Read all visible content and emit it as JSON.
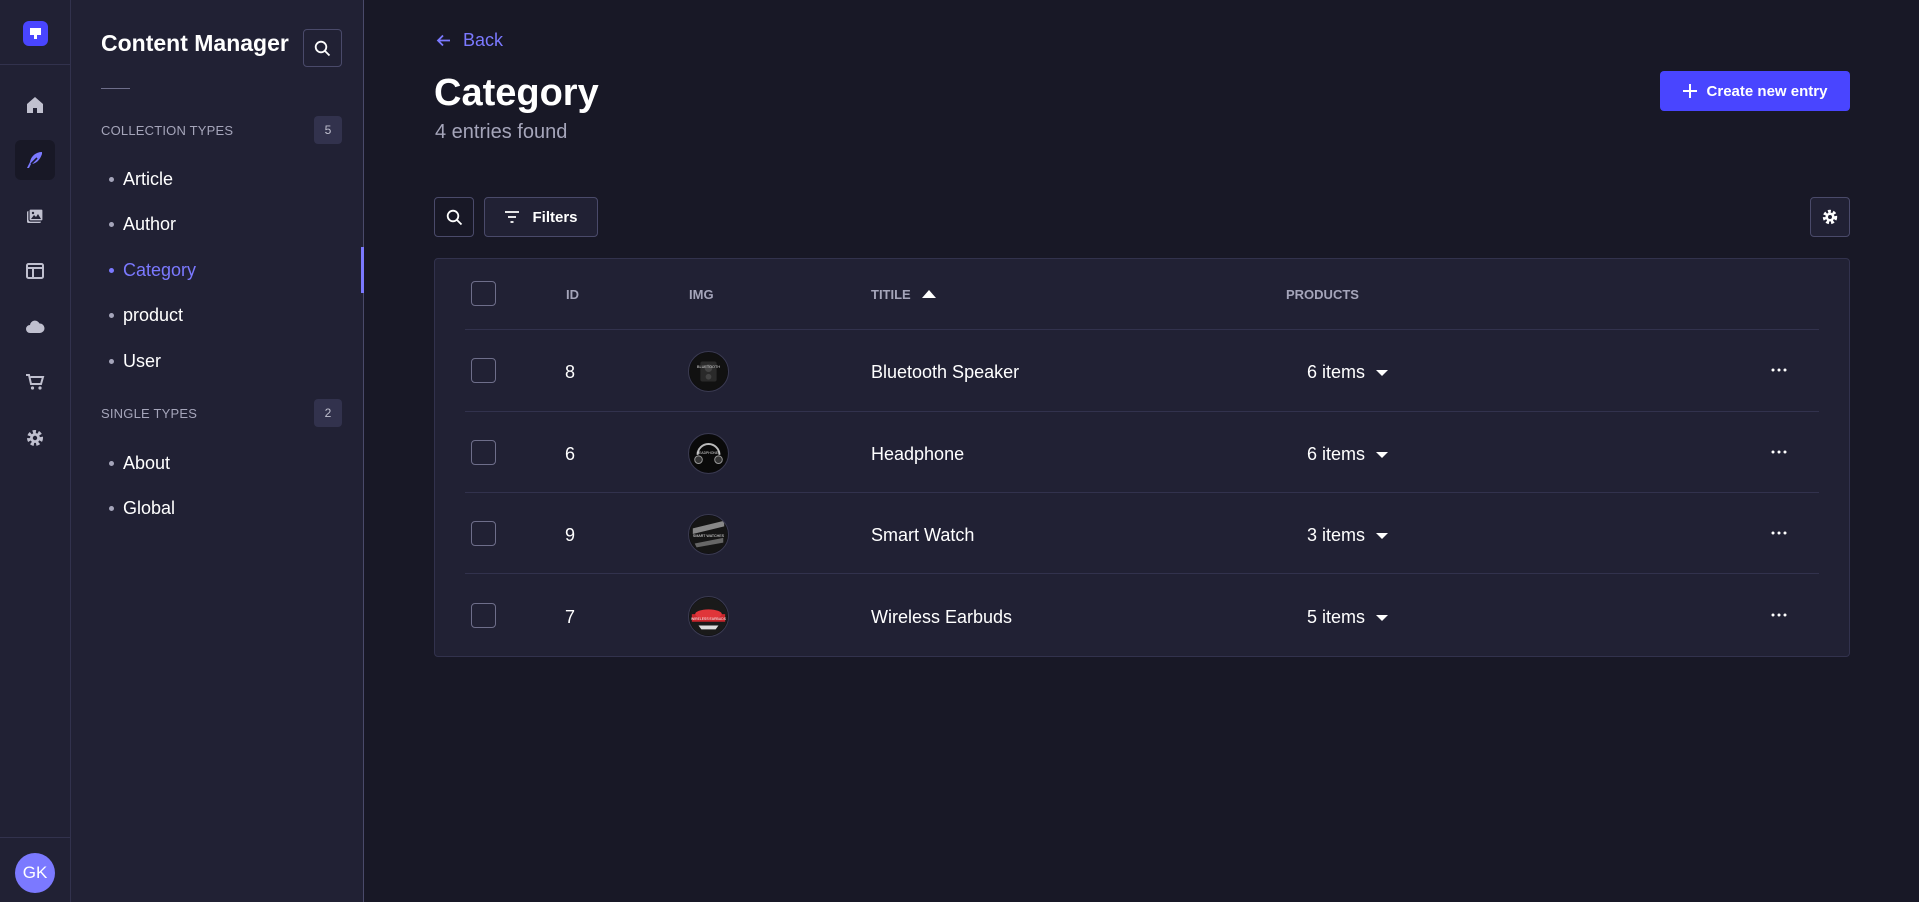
{
  "sidebar": {
    "title": "Content Manager",
    "collection_types": {
      "heading": "COLLECTION TYPES",
      "count": "5",
      "items": [
        {
          "label": "Article"
        },
        {
          "label": "Author"
        },
        {
          "label": "Category"
        },
        {
          "label": "product"
        },
        {
          "label": "User"
        }
      ]
    },
    "single_types": {
      "heading": "SINGLE TYPES",
      "count": "2",
      "items": [
        {
          "label": "About"
        },
        {
          "label": "Global"
        }
      ]
    },
    "active_item": "Category"
  },
  "rail": {
    "icons": [
      "logo-icon",
      "home-icon",
      "feather-icon",
      "media-icon",
      "layout-icon",
      "cloud-icon",
      "cart-icon",
      "gear-icon"
    ],
    "avatar_initials": "GK"
  },
  "header": {
    "back_label": "Back",
    "title": "Category",
    "subtitle": "4 entries found",
    "create_label": "Create new entry"
  },
  "toolbar": {
    "filters_label": "Filters"
  },
  "table": {
    "columns": {
      "id": "ID",
      "img": "IMG",
      "title": "TITILE",
      "products": "PRODUCTS"
    },
    "rows": [
      {
        "id": "8",
        "title": "Bluetooth Speaker",
        "products": "6 items"
      },
      {
        "id": "6",
        "title": "Headphone",
        "products": "6 items"
      },
      {
        "id": "9",
        "title": "Smart Watch",
        "products": "3 items"
      },
      {
        "id": "7",
        "title": "Wireless Earbuds",
        "products": "5 items"
      }
    ]
  },
  "colors": {
    "accent": "#4945ff",
    "accent_light": "#7b79ff",
    "background": "#181826",
    "panel": "#212134"
  }
}
